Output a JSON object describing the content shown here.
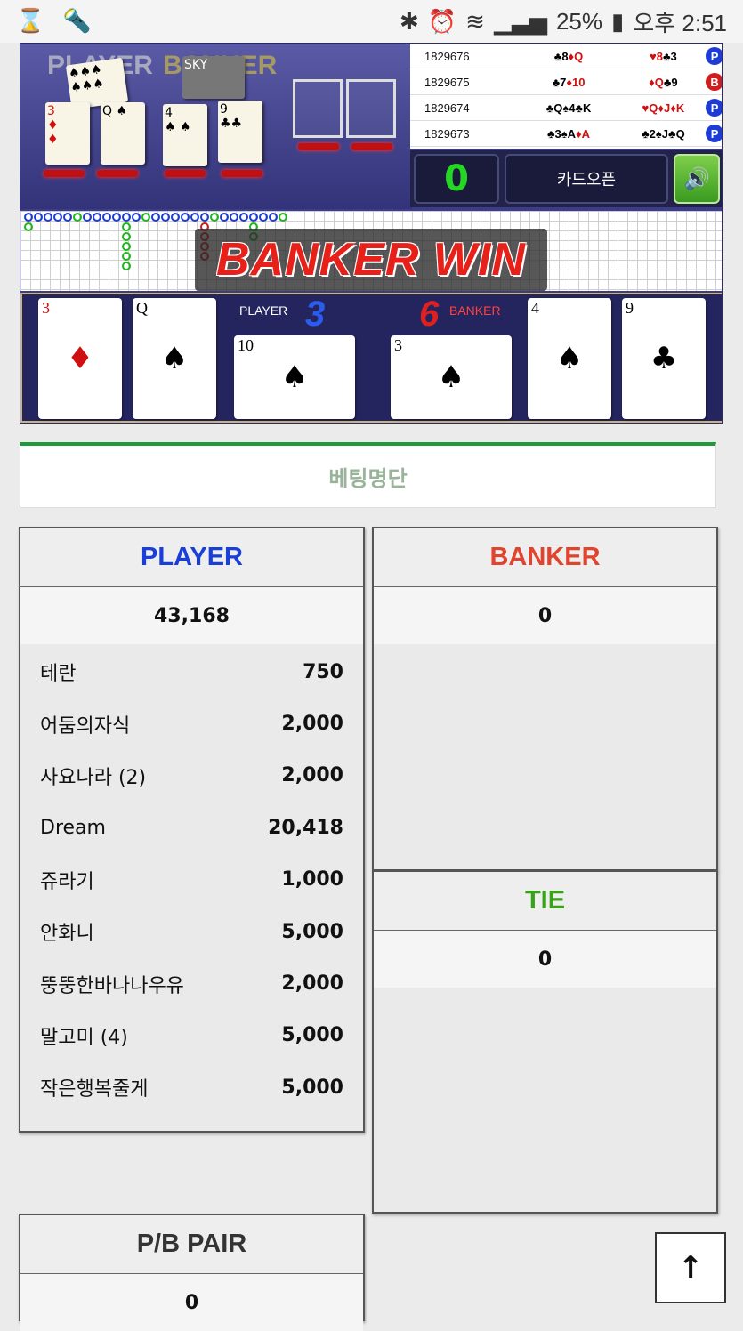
{
  "status_bar": {
    "left_icons": [
      "hourglass-icon",
      "flashlight-icon"
    ],
    "battery": "25%",
    "time": "오후 2:51"
  },
  "game": {
    "stage_player_label": "PLAYER",
    "stage_banker_label": "BANKER",
    "history": [
      {
        "id": "1829676",
        "player": "♣8♦Q",
        "banker": "♥8♣3",
        "result": "P"
      },
      {
        "id": "1829675",
        "player": "♣7♦10",
        "banker": "♦Q♣9",
        "result": "B"
      },
      {
        "id": "1829674",
        "player": "♣Q♠4♣K",
        "banker": "♥Q♦J♦K",
        "result": "P"
      },
      {
        "id": "1829673",
        "player": "♣3♠A♦A",
        "banker": "♣2♠J♣Q",
        "result": "P"
      }
    ],
    "counter": "0",
    "card_open_label": "카드오픈",
    "sound_icon": "speaker-icon",
    "banner_text": "BANKER WIN",
    "player_label": "PLAYER",
    "player_score": "3",
    "banker_label": "BANKER",
    "banker_score": "6",
    "player_cards": [
      {
        "rank": "3",
        "suit": "♦",
        "color": "#d01010"
      },
      {
        "rank": "Q",
        "suit": "♠",
        "color": "#000000"
      },
      {
        "rank": "10",
        "suit": "♠",
        "color": "#000000"
      }
    ],
    "banker_cards": [
      {
        "rank": "3",
        "suit": "♠",
        "color": "#000000"
      },
      {
        "rank": "4",
        "suit": "♠",
        "color": "#000000"
      },
      {
        "rank": "9",
        "suit": "♣",
        "color": "#000000"
      }
    ]
  },
  "betting": {
    "header": "베팅명단",
    "player": {
      "title": "PLAYER",
      "title_color": "#1a3fd9",
      "total": "43,168",
      "bets": [
        {
          "name": "테란",
          "amount": "750"
        },
        {
          "name": "어둠의자식",
          "amount": "2,000"
        },
        {
          "name": "사요나라 (2)",
          "amount": "2,000"
        },
        {
          "name": "Dream",
          "amount": "20,418"
        },
        {
          "name": "쥬라기",
          "amount": "1,000"
        },
        {
          "name": "안화니",
          "amount": "5,000"
        },
        {
          "name": "뚱뚱한바나나우유",
          "amount": "2,000"
        },
        {
          "name": "말고미 (4)",
          "amount": "5,000"
        },
        {
          "name": "작은행복줄게",
          "amount": "5,000"
        }
      ]
    },
    "banker": {
      "title": "BANKER",
      "title_color": "#e0442e",
      "total": "0"
    },
    "tie": {
      "title": "TIE",
      "title_color": "#3aa21a",
      "total": "0"
    },
    "pair": {
      "title": "P/B PAIR",
      "title_color": "#333333",
      "total": "0"
    }
  },
  "scroll_top_icon": "arrow-up-icon"
}
